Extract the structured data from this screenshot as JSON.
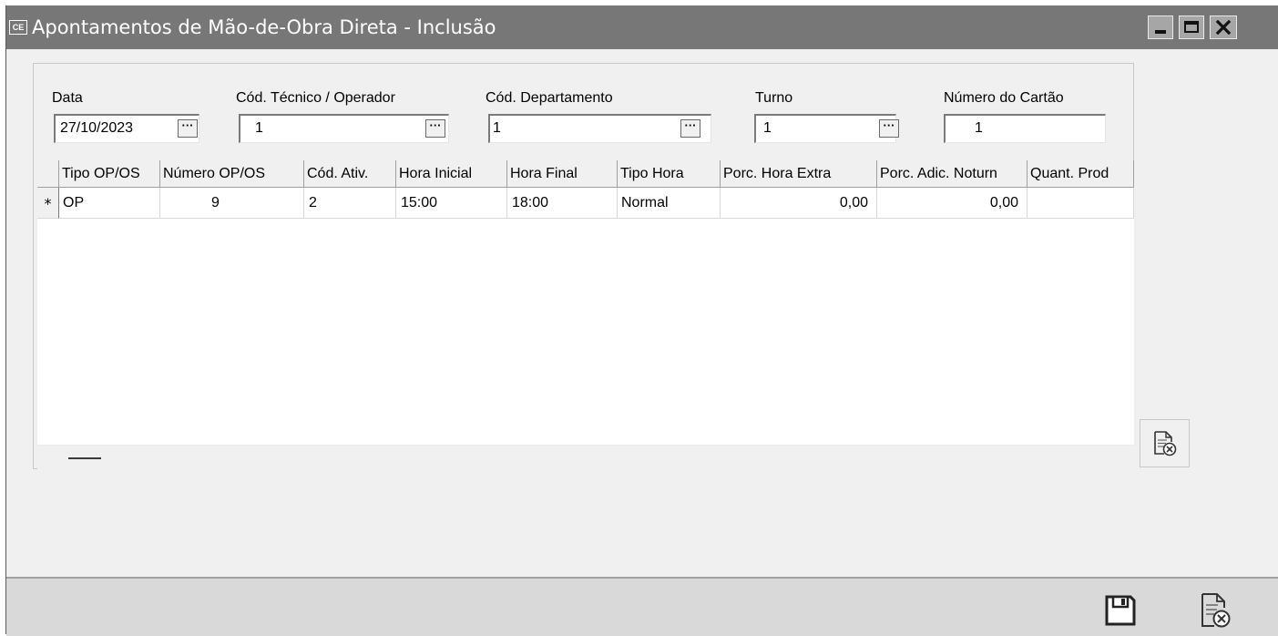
{
  "window": {
    "app_badge": "CE",
    "title": "Apontamentos de Mão-de-Obra Direta - Inclusão",
    "colors": {
      "titlebar": "#777777",
      "background": "#f0f0f0",
      "footer": "#d9d9d9"
    }
  },
  "header": {
    "data": {
      "label": "Data",
      "value": "27/10/2023",
      "button": "···"
    },
    "tecnico": {
      "label": "Cód. Técnico / Operador",
      "value": "1",
      "button": "···"
    },
    "departamento": {
      "label": "Cód. Departamento",
      "value": "1",
      "button": "···"
    },
    "turno": {
      "label": "Turno",
      "value": "1",
      "button": "···"
    },
    "cartao": {
      "label": "Número do Cartão",
      "value": "1"
    }
  },
  "grid": {
    "columns": [
      "Tipo OP/OS",
      "Número OP/OS",
      "Cód. Ativ.",
      "Hora Inicial",
      "Hora Final",
      "Tipo Hora",
      "Porc. Hora Extra",
      "Porc. Adic. Noturn",
      "Quant. Prod"
    ],
    "row_indicator": "*",
    "rows": [
      [
        "OP",
        "9",
        "2",
        "15:00",
        "18:00",
        "Normal",
        "0,00",
        "0,00",
        ""
      ]
    ]
  },
  "icons": {
    "minimize": "minimize-icon",
    "maximize": "maximize-icon",
    "close": "close-icon",
    "delete_row": "delete-document-icon",
    "save": "save-disk-icon",
    "cancel": "cancel-document-icon"
  }
}
